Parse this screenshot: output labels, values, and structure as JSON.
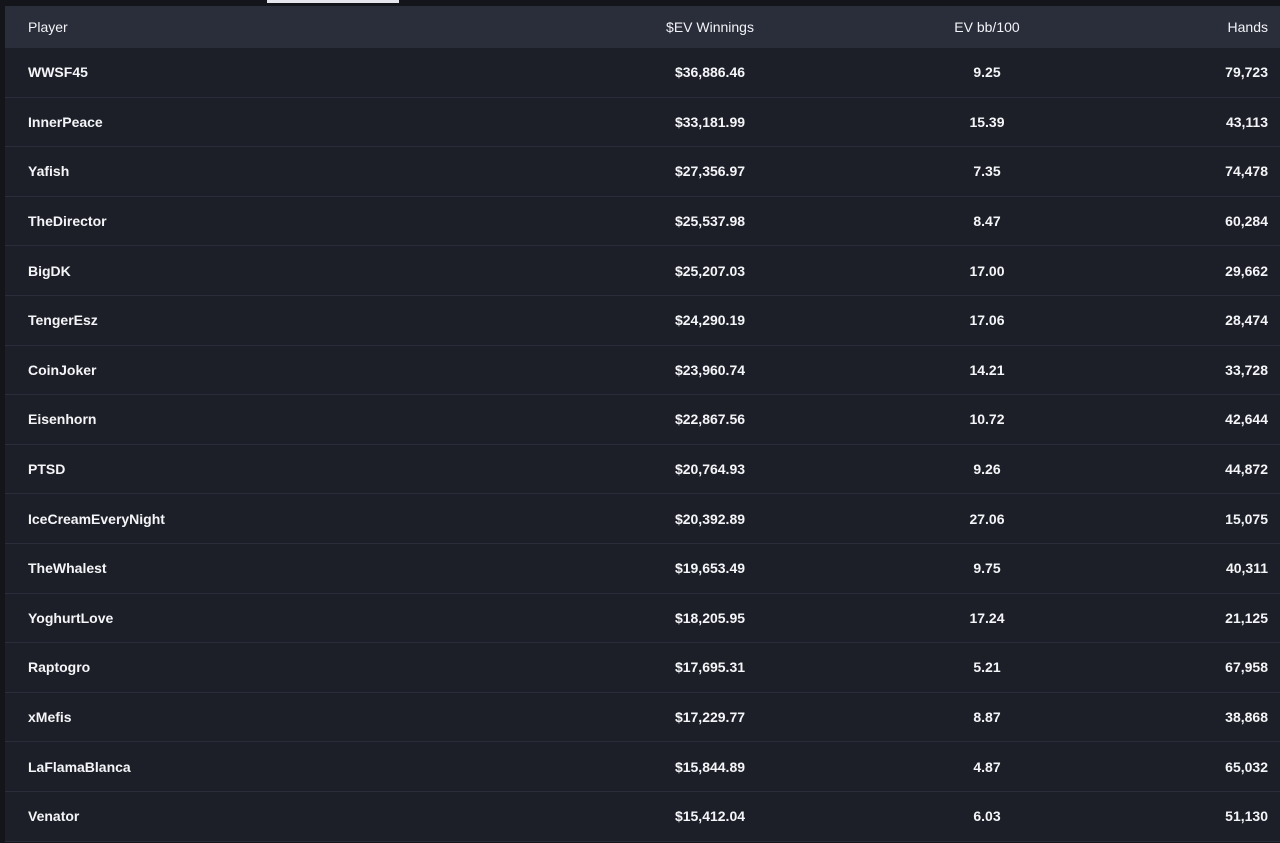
{
  "table": {
    "columns": {
      "player": "Player",
      "ev_winnings": "$EV Winnings",
      "ev_bb100": "EV bb/100",
      "hands": "Hands"
    },
    "rows": [
      {
        "player": "WWSF45",
        "ev_winnings": "$36,886.46",
        "ev_bb100": "9.25",
        "hands": "79,723"
      },
      {
        "player": "InnerPeace",
        "ev_winnings": "$33,181.99",
        "ev_bb100": "15.39",
        "hands": "43,113"
      },
      {
        "player": "Yafish",
        "ev_winnings": "$27,356.97",
        "ev_bb100": "7.35",
        "hands": "74,478"
      },
      {
        "player": "TheDirector",
        "ev_winnings": "$25,537.98",
        "ev_bb100": "8.47",
        "hands": "60,284"
      },
      {
        "player": "BigDK",
        "ev_winnings": "$25,207.03",
        "ev_bb100": "17.00",
        "hands": "29,662"
      },
      {
        "player": "TengerEsz",
        "ev_winnings": "$24,290.19",
        "ev_bb100": "17.06",
        "hands": "28,474"
      },
      {
        "player": "CoinJoker",
        "ev_winnings": "$23,960.74",
        "ev_bb100": "14.21",
        "hands": "33,728"
      },
      {
        "player": "Eisenhorn",
        "ev_winnings": "$22,867.56",
        "ev_bb100": "10.72",
        "hands": "42,644"
      },
      {
        "player": "PTSD",
        "ev_winnings": "$20,764.93",
        "ev_bb100": "9.26",
        "hands": "44,872"
      },
      {
        "player": "IceCreamEveryNight",
        "ev_winnings": "$20,392.89",
        "ev_bb100": "27.06",
        "hands": "15,075"
      },
      {
        "player": "TheWhalest",
        "ev_winnings": "$19,653.49",
        "ev_bb100": "9.75",
        "hands": "40,311"
      },
      {
        "player": "YoghurtLove",
        "ev_winnings": "$18,205.95",
        "ev_bb100": "17.24",
        "hands": "21,125"
      },
      {
        "player": "Raptogro",
        "ev_winnings": "$17,695.31",
        "ev_bb100": "5.21",
        "hands": "67,958"
      },
      {
        "player": "xMefis",
        "ev_winnings": "$17,229.77",
        "ev_bb100": "8.87",
        "hands": "38,868"
      },
      {
        "player": "LaFlamaBlanca",
        "ev_winnings": "$15,844.89",
        "ev_bb100": "4.87",
        "hands": "65,032"
      },
      {
        "player": "Venator",
        "ev_winnings": "$15,412.04",
        "ev_bb100": "6.03",
        "hands": "51,130"
      }
    ]
  },
  "colors": {
    "page_bg": "#14151b",
    "table_bg": "#1d1f28",
    "header_bg": "#2a2d3a",
    "row_divider": "#2b2e3a",
    "text": "#f4f5f8"
  }
}
